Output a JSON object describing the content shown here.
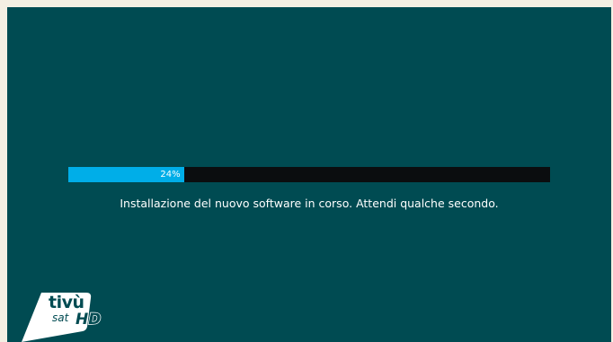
{
  "progress": {
    "percent": 24,
    "label": "24%"
  },
  "status": {
    "message": "Installazione del nuovo software in corso. Attendi qualche secondo."
  },
  "logo": {
    "brand": "tivù",
    "sub": "sat",
    "tag": "HD"
  },
  "colors": {
    "background": "#004b52",
    "progress_fill": "#00aee8",
    "progress_track": "#0b0d0f",
    "text": "#ffffff"
  }
}
